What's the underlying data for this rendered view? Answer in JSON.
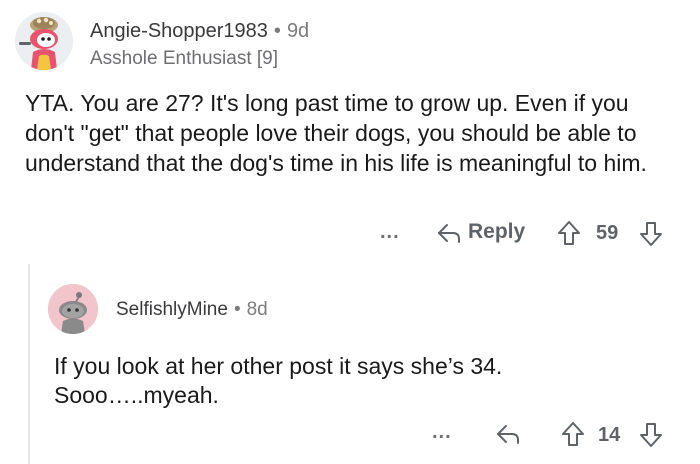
{
  "comments": [
    {
      "username": "Angie-Shopper1983",
      "age": "9d",
      "flair": "Asshole Enthusiast [9]",
      "body": "YTA. You are 27? It's long past time to grow up. Even if you don't \"get\" that people love their dogs, you should be able to understand that the dog's time in his life is meaningful to him.",
      "more_label": "...",
      "reply_label": "Reply",
      "score": "59"
    },
    {
      "username": "SelfishlyMine",
      "age": "8d",
      "body_lines": [
        "If you look at her other post it says she’s 34.",
        "Sooo…..myeah."
      ],
      "more_label": "...",
      "score": "14"
    }
  ],
  "separator": "•",
  "colors": {
    "text": "#1a1a1b",
    "meta": "#7c7c7c",
    "avatar1_bg": "#eceff1",
    "avatar2_bg": "#f2c4cb",
    "snoo_pink": "#e8546f"
  },
  "icons": [
    "snoo-avatar-icon",
    "reply-arrow-icon",
    "upvote-icon",
    "downvote-icon",
    "more-options-icon"
  ]
}
